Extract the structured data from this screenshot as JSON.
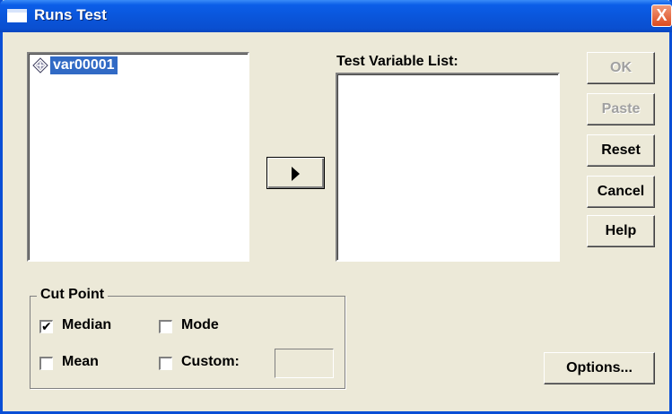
{
  "window": {
    "title": "Runs Test",
    "close_glyph": "X"
  },
  "source_list": {
    "items": [
      {
        "label": "var00001",
        "icon": "scale-variable-icon",
        "selected": true
      }
    ]
  },
  "move_button": {
    "icon": "right-arrow-icon"
  },
  "test_variable_list": {
    "label": "Test Variable List:",
    "items": []
  },
  "buttons": {
    "ok": {
      "label": "OK",
      "enabled": false
    },
    "paste": {
      "label": "Paste",
      "enabled": false
    },
    "reset": {
      "label": "Reset",
      "enabled": true
    },
    "cancel": {
      "label": "Cancel",
      "enabled": true
    },
    "help": {
      "label": "Help",
      "enabled": true
    },
    "options": {
      "label": "Options...",
      "enabled": true
    }
  },
  "cut_point": {
    "title": "Cut Point",
    "median": {
      "label": "Median",
      "checked": true
    },
    "mode": {
      "label": "Mode",
      "checked": false
    },
    "mean": {
      "label": "Mean",
      "checked": false
    },
    "custom": {
      "label": "Custom:",
      "checked": false,
      "value": ""
    }
  },
  "colors": {
    "titlebar": "#0a54d8",
    "dialog_bg": "#ece9d8",
    "selection": "#316ac5",
    "close_button": "#dd4a1e"
  }
}
